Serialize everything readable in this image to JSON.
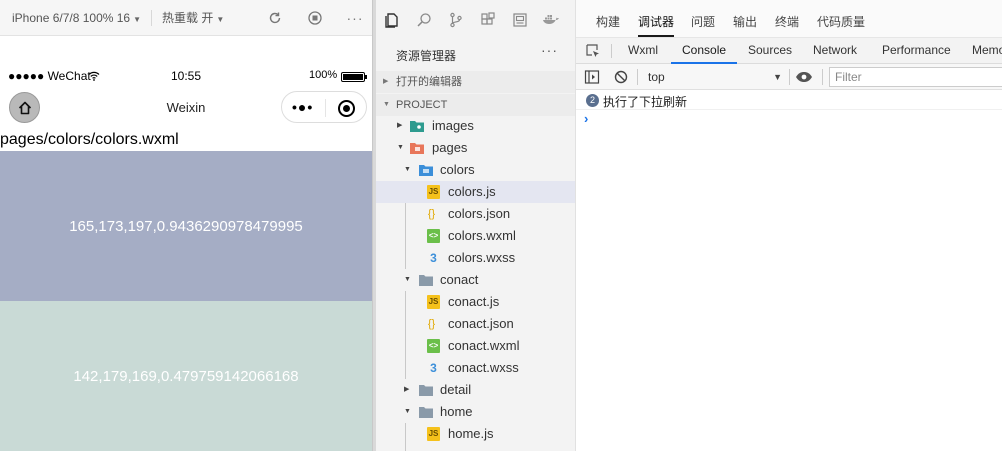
{
  "simulator": {
    "device_label": "iPhone 6/7/8 100% 16",
    "hot_reload_label": "热重载 开",
    "status": {
      "carrier": "●●●●● WeChat",
      "time": "10:55",
      "battery": "100%"
    },
    "nav_title": "Weixin",
    "page_path": "pages/colors/colors.wxml",
    "swatches": [
      {
        "label": "165,173,197,0.9436290978479995",
        "color": "#a5adc5"
      },
      {
        "label": "142,179,169,0.479759142066168",
        "color": "#c9dad6"
      }
    ]
  },
  "explorer": {
    "title": "资源管理器",
    "more": "···",
    "sections": {
      "open_editors": "打开的编辑器",
      "project": "PROJECT"
    },
    "tree": {
      "images": "images",
      "pages": "pages",
      "colors": "colors",
      "colors_js": "colors.js",
      "colors_json": "colors.json",
      "colors_wxml": "colors.wxml",
      "colors_wxss": "colors.wxss",
      "conact": "conact",
      "conact_js": "conact.js",
      "conact_json": "conact.json",
      "conact_wxml": "conact.wxml",
      "conact_wxss": "conact.wxss",
      "detail": "detail",
      "home": "home",
      "home_js": "home.js"
    }
  },
  "top_tabs": [
    "构建",
    "调试器",
    "问题",
    "输出",
    "终端",
    "代码质量"
  ],
  "devtools_tabs": [
    "Wxml",
    "Console",
    "Sources",
    "Network",
    "Performance",
    "Memory"
  ],
  "console": {
    "context": "top",
    "filter_placeholder": "Filter",
    "log_count": "2",
    "log_text": "执行了下拉刷新",
    "prompt": "›"
  }
}
